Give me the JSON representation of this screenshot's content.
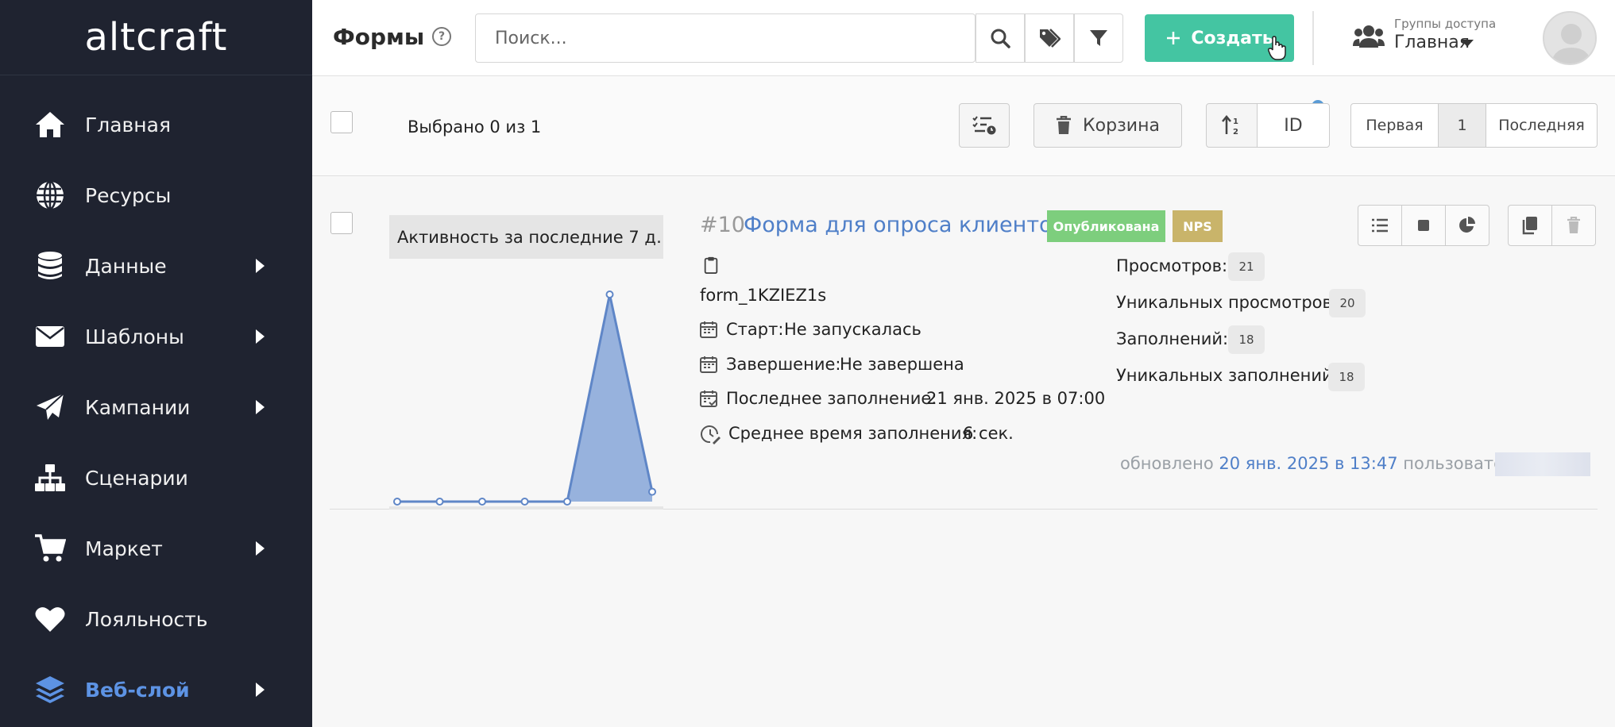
{
  "sidebar": {
    "logo": "altcraft",
    "items": [
      {
        "label": "Главная",
        "icon": "home-icon",
        "has_arrow": false
      },
      {
        "label": "Ресурсы",
        "icon": "globe-icon",
        "has_arrow": false
      },
      {
        "label": "Данные",
        "icon": "database-icon",
        "has_arrow": true
      },
      {
        "label": "Шаблоны",
        "icon": "envelope-icon",
        "has_arrow": true
      },
      {
        "label": "Кампании",
        "icon": "paper-plane-icon",
        "has_arrow": true
      },
      {
        "label": "Сценарии",
        "icon": "sitemap-icon",
        "has_arrow": false
      },
      {
        "label": "Маркет",
        "icon": "cart-icon",
        "has_arrow": true
      },
      {
        "label": "Лояльность",
        "icon": "heart-icon",
        "has_arrow": false
      },
      {
        "label": "Веб-слой",
        "icon": "layers-icon",
        "has_arrow": true,
        "active": true
      }
    ]
  },
  "header": {
    "title": "Формы",
    "search_placeholder": "Поиск...",
    "create_label": "Создать",
    "groups_caption": "Группы доступа",
    "groups_value": "Главная"
  },
  "toolbar": {
    "selected_text": "Выбрано 0 из 1",
    "trash_label": "Корзина",
    "sort_label": "ID",
    "pagination": {
      "first": "Первая",
      "current": "1",
      "last": "Последняя"
    }
  },
  "form": {
    "id": "#10",
    "name": "Форма для опроса клиентов",
    "status_tag": "Опубликована",
    "type_tag": "NPS",
    "code": "form_1KZIEZ1s",
    "start_label": "Старт:",
    "start_value": "Не запускалась",
    "end_label": "Завершение:",
    "end_value": "Не завершена",
    "last_fill_label": "Последнее заполнение:",
    "last_fill_value": "21 янв. 2025 в 07:00",
    "avg_time_label": "Среднее время заполнения:",
    "avg_time_value": "6 сек.",
    "stats": [
      {
        "label": "Просмотров:",
        "value": "21"
      },
      {
        "label": "Уникальных просмотров:",
        "value": "20"
      },
      {
        "label": "Заполнений:",
        "value": "18"
      },
      {
        "label": "Уникальных заполнений:",
        "value": "18"
      }
    ],
    "updated_prefix": "обновлено",
    "updated_date": "20 янв. 2025 в 13:47",
    "updated_suffix": "пользователем"
  },
  "chart_data": {
    "type": "area",
    "title": "Активность за последние 7 д…",
    "values": [
      0,
      0,
      0,
      0,
      0,
      21,
      1
    ],
    "color": "#7ea0d6",
    "line_color": "#5f86c7"
  },
  "colors": {
    "sidebar_bg": "#1f2330",
    "accent": "#5d93e4",
    "create_button": "#44c5a2",
    "status_published": "#7dce7d",
    "tag_nps": "#c9b46a"
  }
}
